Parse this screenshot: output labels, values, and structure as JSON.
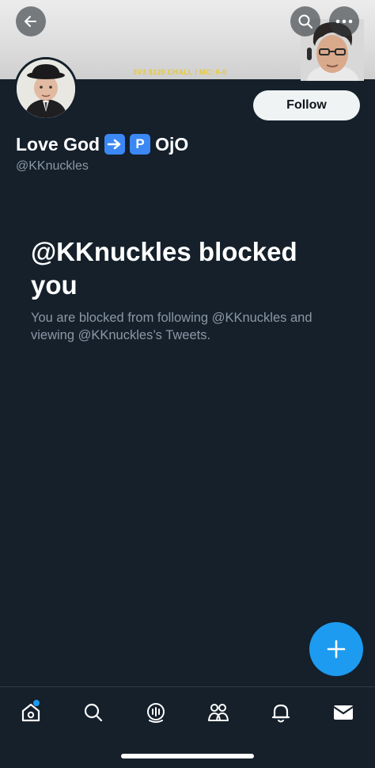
{
  "banner": {
    "stream_overlay_text": "3V3 $120 CHALL / MC: 0-0"
  },
  "header": {
    "back_icon": "arrow-left-icon",
    "search_icon": "search-icon",
    "more_icon": "more-horizontal-icon"
  },
  "profile": {
    "display_name": "Love God",
    "emoji_arrow": "➡",
    "emoji_p": "P",
    "name_suffix": "OjO",
    "handle": "@KKnuckles",
    "follow_label": "Follow",
    "emoji_color": "#3b88f5"
  },
  "blocked": {
    "title": "@KKnuckles blocked you",
    "description": "You are blocked from following @KKnuckles and viewing @KKnuckles’s Tweets."
  },
  "nav": {
    "items": [
      "home-icon",
      "search-icon",
      "spaces-icon",
      "communities-icon",
      "notifications-icon",
      "messages-icon"
    ]
  },
  "colors": {
    "background": "#15202b",
    "accent": "#1d9bf0",
    "secondary_text": "#8b98a5"
  }
}
